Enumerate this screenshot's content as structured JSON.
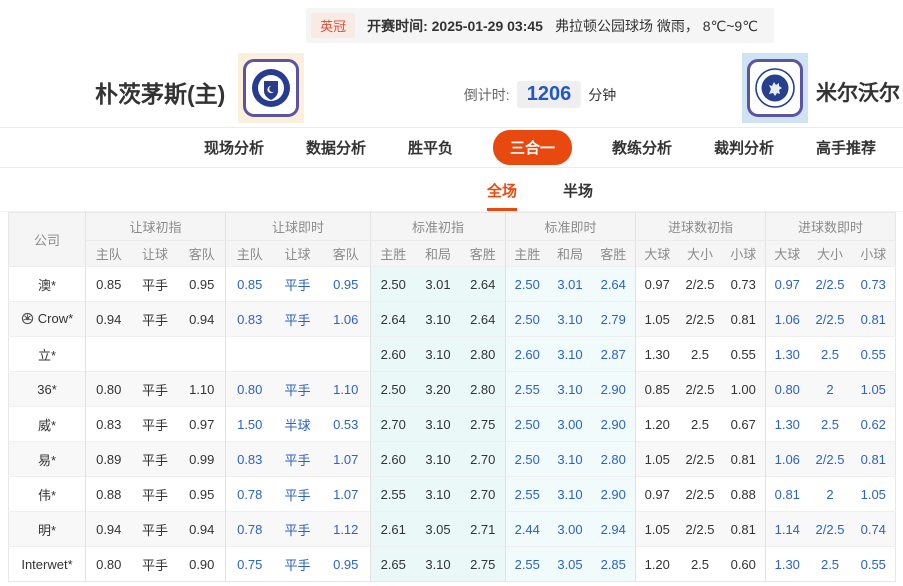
{
  "info_bar": {
    "league": "英冠",
    "kickoff_label": "开赛时间:",
    "kickoff_time": "2025-01-29 03:45",
    "venue": "弗拉顿公园球场",
    "weather": "微雨， 8℃~9℃"
  },
  "match": {
    "home_name": "朴茨茅斯(主)",
    "away_name": "米尔沃尔",
    "countdown_label": "倒计时:",
    "countdown_value": "1206",
    "countdown_unit": "分钟"
  },
  "tabs": {
    "items": [
      "现场分析",
      "数据分析",
      "胜平负",
      "三合一",
      "教练分析",
      "裁判分析",
      "高手推荐"
    ],
    "active": "三合一"
  },
  "subtabs": {
    "items": [
      "全场",
      "半场"
    ],
    "active": "全场"
  },
  "icons": {
    "crow_row": "soccer-ball-icon",
    "home_badge": "home-team-crest-icon",
    "away_badge": "away-team-crest-icon"
  },
  "colors": {
    "accent": "#e8490f",
    "live_blue": "#2a62c9",
    "countdown_blue": "#2356c8",
    "standard_initial_bg": "#ebf8f8",
    "standard_live_bg": "#f1fbfc",
    "league_badge_text": "#d9503c"
  },
  "table": {
    "company_header": "公司",
    "groups": [
      {
        "label": "让球初指",
        "cols": [
          "主队",
          "让球",
          "客队"
        ]
      },
      {
        "label": "让球即时",
        "cols": [
          "主队",
          "让球",
          "客队"
        ]
      },
      {
        "label": "标准初指",
        "cols": [
          "主胜",
          "和局",
          "客胜"
        ]
      },
      {
        "label": "标准即时",
        "cols": [
          "主胜",
          "和局",
          "客胜"
        ]
      },
      {
        "label": "进球数初指",
        "cols": [
          "大球",
          "大小",
          "小球"
        ]
      },
      {
        "label": "进球数即时",
        "cols": [
          "大球",
          "大小",
          "小球"
        ]
      }
    ],
    "rows": [
      {
        "company": "澳*",
        "handicap_initial": [
          "0.85",
          "平手",
          "0.95"
        ],
        "handicap_live": [
          "0.85",
          "平手",
          "0.95"
        ],
        "standard_initial": [
          "2.50",
          "3.01",
          "2.64"
        ],
        "standard_live": [
          "2.50",
          "3.01",
          "2.64"
        ],
        "goals_initial": [
          "0.97",
          "2/2.5",
          "0.73"
        ],
        "goals_live": [
          "0.97",
          "2/2.5",
          "0.73"
        ]
      },
      {
        "company": "Crow*",
        "icon": "soccer-ball-icon",
        "handicap_initial": [
          "0.94",
          "平手",
          "0.94"
        ],
        "handicap_live": [
          "0.83",
          "平手",
          "1.06"
        ],
        "standard_initial": [
          "2.64",
          "3.10",
          "2.64"
        ],
        "standard_live": [
          "2.50",
          "3.10",
          "2.79"
        ],
        "goals_initial": [
          "1.05",
          "2/2.5",
          "0.81"
        ],
        "goals_live": [
          "1.06",
          "2/2.5",
          "0.81"
        ]
      },
      {
        "company": "立*",
        "handicap_initial": [
          "",
          "",
          ""
        ],
        "handicap_live": [
          "",
          "",
          ""
        ],
        "standard_initial": [
          "2.60",
          "3.10",
          "2.80"
        ],
        "standard_live": [
          "2.60",
          "3.10",
          "2.87"
        ],
        "goals_initial": [
          "1.30",
          "2.5",
          "0.55"
        ],
        "goals_live": [
          "1.30",
          "2.5",
          "0.55"
        ]
      },
      {
        "company": "36*",
        "handicap_initial": [
          "0.80",
          "平手",
          "1.10"
        ],
        "handicap_live": [
          "0.80",
          "平手",
          "1.10"
        ],
        "standard_initial": [
          "2.50",
          "3.20",
          "2.80"
        ],
        "standard_live": [
          "2.55",
          "3.10",
          "2.90"
        ],
        "goals_initial": [
          "0.85",
          "2/2.5",
          "1.00"
        ],
        "goals_live": [
          "0.80",
          "2",
          "1.05"
        ]
      },
      {
        "company": "威*",
        "handicap_initial": [
          "0.83",
          "平手",
          "0.97"
        ],
        "handicap_live": [
          "1.50",
          "半球",
          "0.53"
        ],
        "standard_initial": [
          "2.70",
          "3.10",
          "2.75"
        ],
        "standard_live": [
          "2.50",
          "3.00",
          "2.90"
        ],
        "goals_initial": [
          "1.20",
          "2.5",
          "0.67"
        ],
        "goals_live": [
          "1.30",
          "2.5",
          "0.62"
        ]
      },
      {
        "company": "易*",
        "handicap_initial": [
          "0.89",
          "平手",
          "0.99"
        ],
        "handicap_live": [
          "0.83",
          "平手",
          "1.07"
        ],
        "standard_initial": [
          "2.60",
          "3.10",
          "2.70"
        ],
        "standard_live": [
          "2.50",
          "3.10",
          "2.80"
        ],
        "goals_initial": [
          "1.05",
          "2/2.5",
          "0.81"
        ],
        "goals_live": [
          "1.06",
          "2/2.5",
          "0.81"
        ]
      },
      {
        "company": "伟*",
        "handicap_initial": [
          "0.88",
          "平手",
          "0.95"
        ],
        "handicap_live": [
          "0.78",
          "平手",
          "1.07"
        ],
        "standard_initial": [
          "2.55",
          "3.10",
          "2.70"
        ],
        "standard_live": [
          "2.55",
          "3.10",
          "2.90"
        ],
        "goals_initial": [
          "0.97",
          "2/2.5",
          "0.88"
        ],
        "goals_live": [
          "0.81",
          "2",
          "1.05"
        ]
      },
      {
        "company": "明*",
        "handicap_initial": [
          "0.94",
          "平手",
          "0.94"
        ],
        "handicap_live": [
          "0.78",
          "平手",
          "1.12"
        ],
        "standard_initial": [
          "2.61",
          "3.05",
          "2.71"
        ],
        "standard_live": [
          "2.44",
          "3.00",
          "2.94"
        ],
        "goals_initial": [
          "1.05",
          "2/2.5",
          "0.81"
        ],
        "goals_live": [
          "1.14",
          "2/2.5",
          "0.74"
        ]
      },
      {
        "company": "Interwet*",
        "handicap_initial": [
          "0.80",
          "平手",
          "0.90"
        ],
        "handicap_live": [
          "0.75",
          "平手",
          "0.95"
        ],
        "standard_initial": [
          "2.65",
          "3.10",
          "2.75"
        ],
        "standard_live": [
          "2.55",
          "3.05",
          "2.85"
        ],
        "goals_initial": [
          "1.20",
          "2.5",
          "0.60"
        ],
        "goals_live": [
          "1.30",
          "2.5",
          "0.55"
        ]
      }
    ]
  }
}
